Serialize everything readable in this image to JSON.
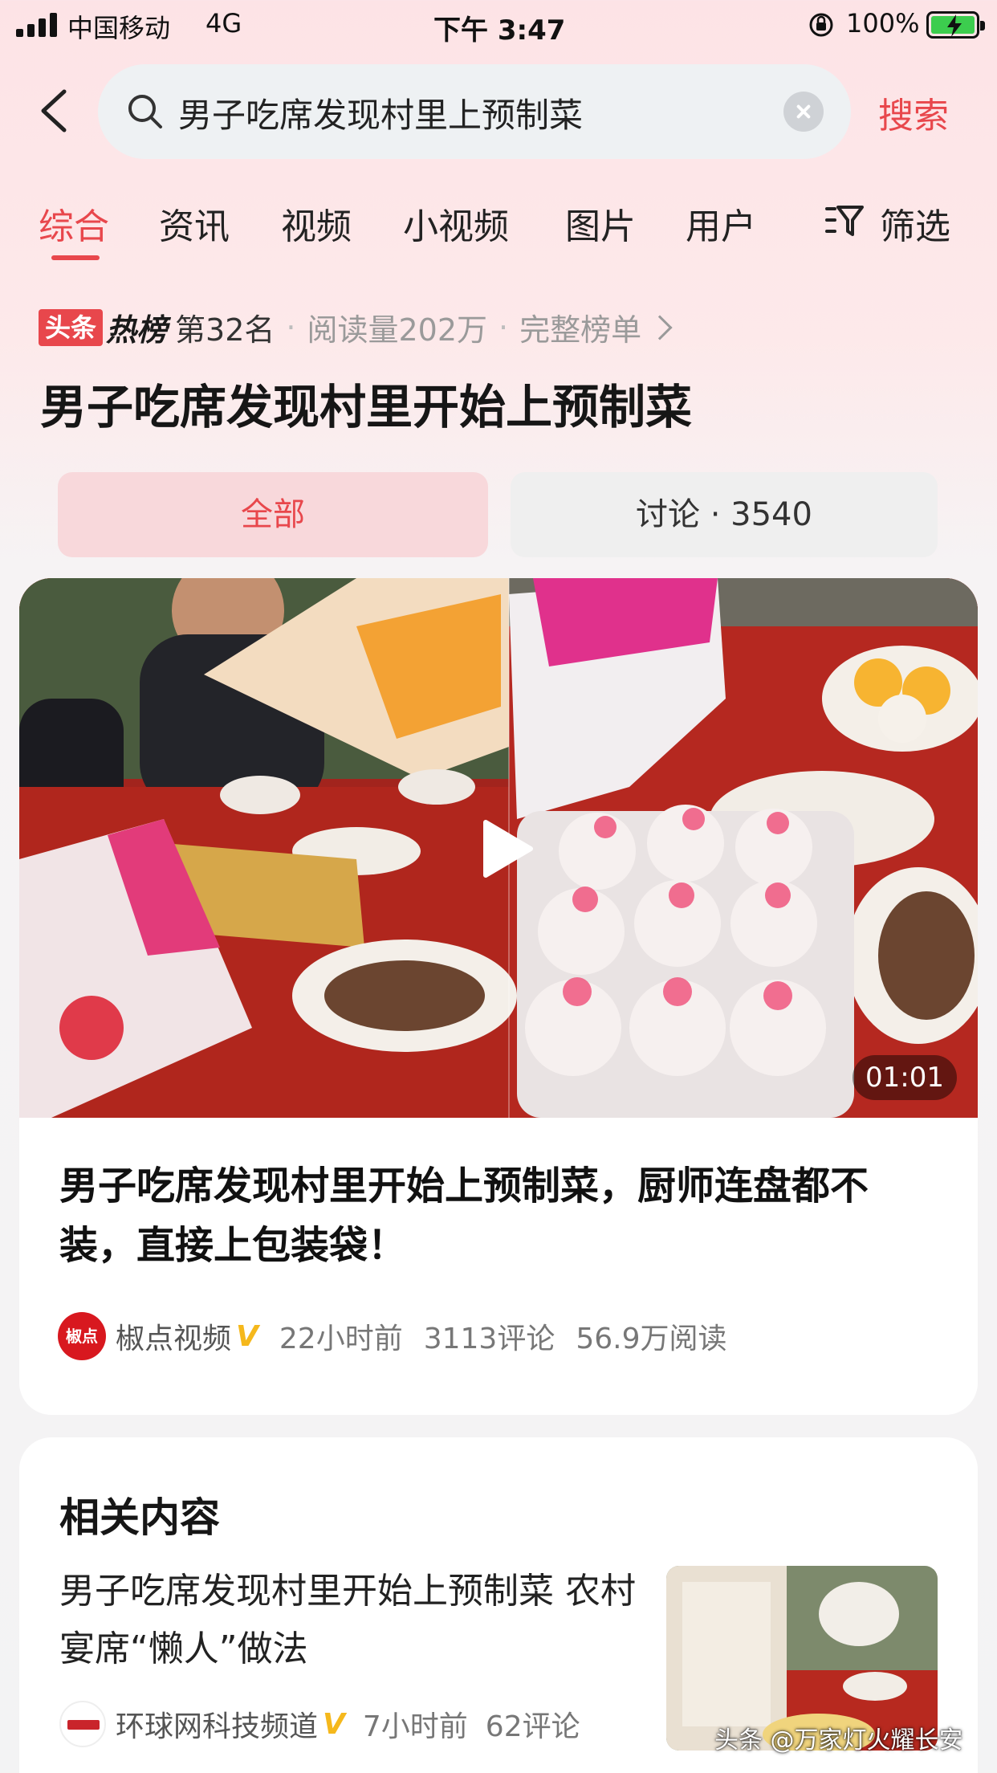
{
  "status_bar": {
    "carrier": "中国移动",
    "network": "4G",
    "time": "下午 3:47",
    "battery_percent": "100%"
  },
  "search": {
    "query": "男子吃席发现村里上预制菜",
    "submit_label": "搜索"
  },
  "tabs": [
    {
      "label": "综合",
      "active": true
    },
    {
      "label": "资讯",
      "active": false
    },
    {
      "label": "视频",
      "active": false
    },
    {
      "label": "小视频",
      "active": false
    },
    {
      "label": "图片",
      "active": false
    },
    {
      "label": "用户",
      "active": false
    }
  ],
  "filter_label": "筛选",
  "hot_list": {
    "badge": "头条",
    "title": "热榜",
    "rank": "第32名",
    "reads": "阅读量202万",
    "full_list_label": "完整榜单"
  },
  "topic_title": "男子吃席发现村里开始上预制菜",
  "segments": {
    "all": "全部",
    "discussion": "讨论 · 3540"
  },
  "main_card": {
    "duration": "01:01",
    "title": "男子吃席发现村里开始上预制菜，厨师连盘都不装，直接上包装袋！",
    "avatar_text": "椒点",
    "author": "椒点视频",
    "verified": "V",
    "time_ago": "22小时前",
    "comments": "3113评论",
    "reads": "56.9万阅读"
  },
  "related": {
    "heading": "相关内容",
    "title": "男子吃席发现村里开始上预制菜 农村宴席“懒人”做法",
    "author": "环球网科技频道",
    "verified": "V",
    "time_ago": "7小时前",
    "comments": "62评论"
  },
  "watermark": "头条 @万家灯火耀长安",
  "colors": {
    "accent": "#e8474c",
    "verified": "#f5b81c",
    "battery": "#3ccd4e"
  }
}
